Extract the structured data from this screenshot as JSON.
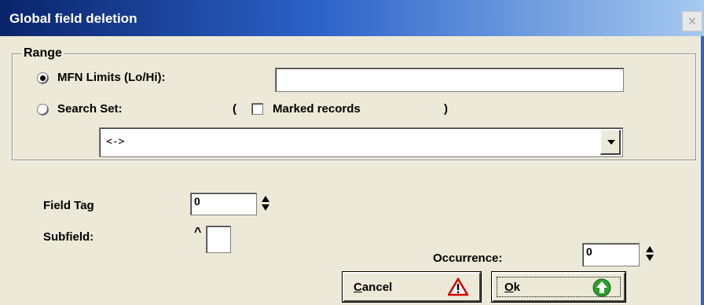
{
  "window": {
    "title": "Global field deletion",
    "close_label": "×"
  },
  "range": {
    "legend": "Range",
    "mfn_label": "MFN Limits (Lo/Hi):",
    "mfn_value": "",
    "mfn_selected": true,
    "search_set_label": "Search Set:",
    "paren_open": "(",
    "paren_close": ")",
    "marked_records_label": "Marked records",
    "marked_records_checked": false,
    "search_set_value": "<->"
  },
  "field_tag": {
    "label": "Field Tag",
    "value": "0"
  },
  "subfield": {
    "label": "Subfield:",
    "caret": "^",
    "value": ""
  },
  "occurrence": {
    "label": "Occurrence:",
    "value": "0"
  },
  "buttons": {
    "cancel_label": "Cancel",
    "ok_label": "Ok"
  },
  "icons": {
    "cancel": "warning-icon",
    "ok": "green-up-arrow-icon"
  },
  "colors": {
    "title_bar_start": "#0a246a",
    "title_bar_end": "#a6caf0",
    "dialog_bg": "#ece9d8",
    "ok_icon": "#2e9e2e",
    "warning_icon": "#d40000"
  }
}
